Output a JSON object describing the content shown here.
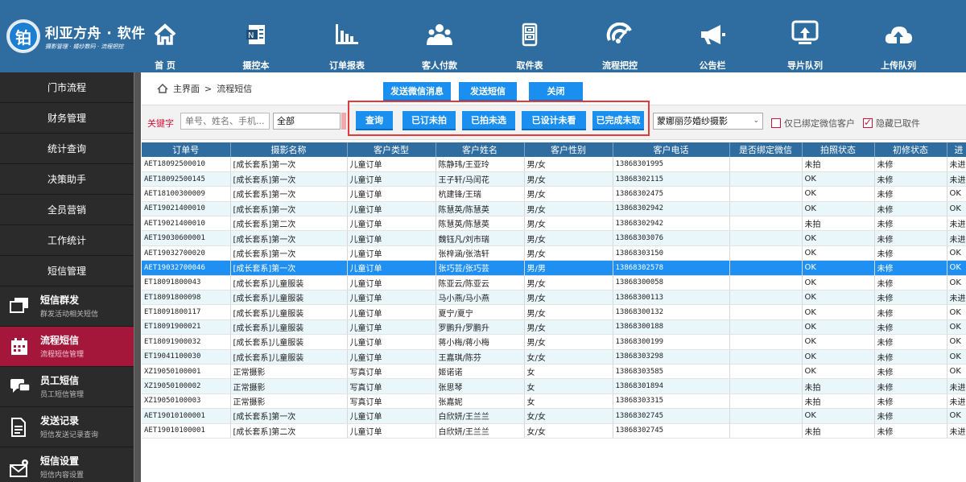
{
  "app": {
    "logo_char": "铂",
    "logo_title": "利亚方舟 · 软件",
    "logo_subtitle": "摄影管理 · 婚纱数码 · 流程把控"
  },
  "nav": [
    {
      "label": "首 页",
      "icon": "home-icon"
    },
    {
      "label": "摄控本",
      "icon": "notebook-icon"
    },
    {
      "label": "订单报表",
      "icon": "bar-chart-icon"
    },
    {
      "label": "客人付款",
      "icon": "customers-icon"
    },
    {
      "label": "取件表",
      "icon": "cabinet-icon"
    },
    {
      "label": "流程把控",
      "icon": "speed-signal-icon"
    },
    {
      "label": "公告栏",
      "icon": "megaphone-icon"
    },
    {
      "label": "导片队列",
      "icon": "upload-screen-icon"
    },
    {
      "label": "上传队列",
      "icon": "cloud-upload-icon"
    }
  ],
  "sidebar": {
    "plain_items": [
      "门市流程",
      "财务管理",
      "统计查询",
      "决策助手",
      "全员营销",
      "工作统计",
      "短信管理"
    ],
    "rich_items": [
      {
        "title": "短信群发",
        "subtitle": "群发活动相关短信",
        "icon": "screens-icon",
        "active": false
      },
      {
        "title": "流程短信",
        "subtitle": "流程短信管理",
        "icon": "calendar-icon",
        "active": true
      },
      {
        "title": "员工短信",
        "subtitle": "员工短信管理",
        "icon": "chat-icon",
        "active": false
      },
      {
        "title": "发送记录",
        "subtitle": "短信发送记录查询",
        "icon": "document-icon",
        "active": false
      },
      {
        "title": "短信设置",
        "subtitle": "短信内容设置",
        "icon": "mail-gear-icon",
        "active": false
      }
    ]
  },
  "breadcrumb": {
    "home": "主界面",
    "separator": ">",
    "current": "流程短信"
  },
  "toolbar": {
    "send_wechat": "发送微信消息",
    "send_sms": "发送短信",
    "close": "关闭"
  },
  "filter": {
    "keyword_label": "关键字",
    "keyword_placeholder": "单号、姓名、手机...",
    "scope_value": "全部",
    "query": "查询",
    "ordered_unshot": "已订未拍",
    "shot_unselected": "已拍未选",
    "designed_unviewed": "已设计未看",
    "completed_unpicked": "已完成未取",
    "store_value": "蒙娜丽莎婚纱摄影",
    "only_bound_wechat": "仅已绑定微信客户",
    "hide_picked": "隐藏已取件",
    "only_bound_checked": false,
    "hide_picked_checked": true
  },
  "table": {
    "columns": [
      "订单号",
      "摄影名称",
      "客户类型",
      "客户姓名",
      "客户性别",
      "客户电话",
      "是否绑定微信",
      "拍照状态",
      "初修状态",
      "进"
    ],
    "selected_index": 7,
    "rows": [
      [
        "AET18092500010",
        "[成长套系]第一次",
        "儿童订单",
        "陈静玮/王亚玲",
        "男/女",
        "13868301995",
        "",
        "未拍",
        "未修",
        "未进"
      ],
      [
        "AET18092500145",
        "[成长套系]第一次",
        "儿童订单",
        "王子轩/马闰花",
        "男/女",
        "13868302115",
        "",
        "OK",
        "未修",
        "未进"
      ],
      [
        "AET18100300009",
        "[成长套系]第一次",
        "儿童订单",
        "杭建锋/王瑞",
        "男/女",
        "13868302475",
        "",
        "OK",
        "未修",
        "OK"
      ],
      [
        "AET19021400010",
        "[成长套系]第一次",
        "儿童订单",
        "陈慧英/陈慧英",
        "男/女",
        "13868302942",
        "",
        "OK",
        "未修",
        "OK"
      ],
      [
        "AET19021400010",
        "[成长套系]第二次",
        "儿童订单",
        "陈慧英/陈慧英",
        "男/女",
        "13868302942",
        "",
        "未拍",
        "未修",
        "未进"
      ],
      [
        "AET19030600001",
        "[成长套系]第一次",
        "儿童订单",
        "魏钰凡/刘市瑞",
        "男/女",
        "13868303076",
        "",
        "OK",
        "未修",
        "未进"
      ],
      [
        "AET19032700020",
        "[成长套系]第一次",
        "儿童订单",
        "张梓涵/张浩轩",
        "男/女",
        "13868303150",
        "",
        "OK",
        "未修",
        "OK"
      ],
      [
        "AET19032700046",
        "[成长套系]第一次",
        "儿童订单",
        "张巧芸/张巧芸",
        "男/男",
        "13868302578",
        "",
        "OK",
        "未修",
        "OK"
      ],
      [
        "ET18091800043",
        "[成长套系]儿童服装",
        "儿童订单",
        "陈亚云/陈亚云",
        "男/女",
        "13868300058",
        "",
        "OK",
        "未修",
        "OK"
      ],
      [
        "ET18091800098",
        "[成长套系]儿童服装",
        "儿童订单",
        "马小燕/马小燕",
        "男/女",
        "13868300113",
        "",
        "OK",
        "未修",
        "未进"
      ],
      [
        "ET18091800117",
        "[成长套系]儿童服装",
        "儿童订单",
        "夏宁/夏宁",
        "男/女",
        "13868300132",
        "",
        "OK",
        "未修",
        "OK"
      ],
      [
        "ET18091900021",
        "[成长套系]儿童服装",
        "儿童订单",
        "罗鹏升/罗鹏升",
        "男/女",
        "13868300188",
        "",
        "OK",
        "未修",
        "OK"
      ],
      [
        "ET18091900032",
        "[成长套系]儿童服装",
        "儿童订单",
        "蒋小梅/蒋小梅",
        "男/女",
        "13868300199",
        "",
        "OK",
        "未修",
        "OK"
      ],
      [
        "ET19041100030",
        "[成长套系]儿童服装",
        "儿童订单",
        "王嘉琪/陈芬",
        "女/女",
        "13868303298",
        "",
        "OK",
        "未修",
        "OK"
      ],
      [
        "XZ19050100001",
        "正常摄影",
        "写真订单",
        "姬诺诺",
        "女",
        "13868303585",
        "",
        "OK",
        "未修",
        "OK"
      ],
      [
        "XZ19050100002",
        "正常摄影",
        "写真订单",
        "张思琴",
        "女",
        "13868301894",
        "",
        "未拍",
        "未修",
        "未进"
      ],
      [
        "XZ19050100003",
        "正常摄影",
        "写真订单",
        "张嘉妮",
        "女",
        "13868303315",
        "",
        "未拍",
        "未修",
        "未进"
      ],
      [
        "AET19010100001",
        "[成长套系]第一次",
        "儿童订单",
        "白欣妍/王兰兰",
        "女/女",
        "13868302745",
        "",
        "OK",
        "未修",
        "OK"
      ],
      [
        "AET19010100001",
        "[成长套系]第二次",
        "儿童订单",
        "白欣妍/王兰兰",
        "女/女",
        "13868302745",
        "",
        "未拍",
        "未修",
        "未进"
      ]
    ]
  }
}
